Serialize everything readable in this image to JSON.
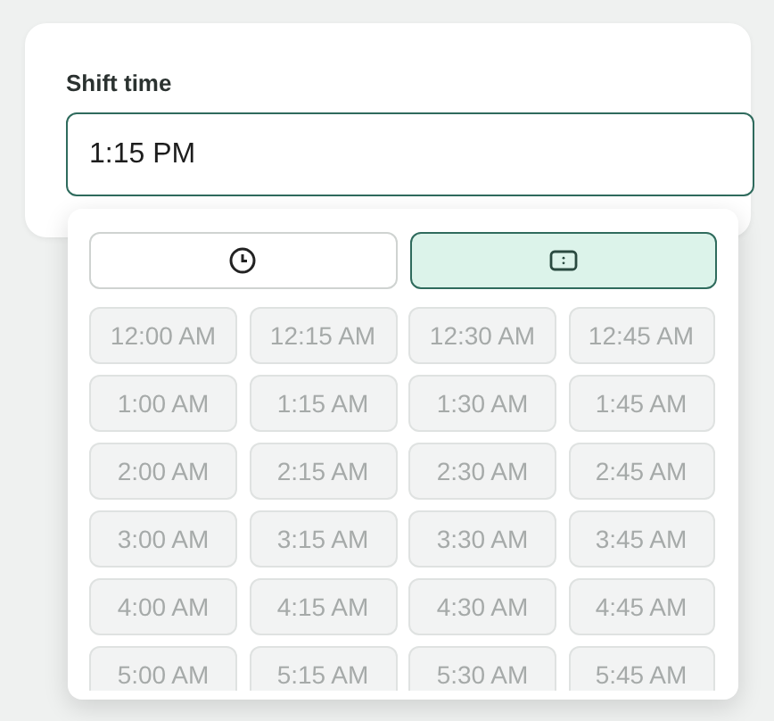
{
  "field": {
    "label": "Shift time",
    "value": "1:15 PM"
  },
  "modes": [
    {
      "kind": "clock",
      "selected": false
    },
    {
      "kind": "keyboard",
      "selected": true
    }
  ],
  "slots": [
    {
      "label": "12:00 AM",
      "disabled": true
    },
    {
      "label": "12:15 AM",
      "disabled": true
    },
    {
      "label": "12:30 AM",
      "disabled": true
    },
    {
      "label": "12:45 AM",
      "disabled": true
    },
    {
      "label": "1:00 AM",
      "disabled": true
    },
    {
      "label": "1:15 AM",
      "disabled": true
    },
    {
      "label": "1:30 AM",
      "disabled": true
    },
    {
      "label": "1:45 AM",
      "disabled": true
    },
    {
      "label": "2:00 AM",
      "disabled": true
    },
    {
      "label": "2:15 AM",
      "disabled": true
    },
    {
      "label": "2:30 AM",
      "disabled": true
    },
    {
      "label": "2:45 AM",
      "disabled": true
    },
    {
      "label": "3:00 AM",
      "disabled": true
    },
    {
      "label": "3:15 AM",
      "disabled": true
    },
    {
      "label": "3:30 AM",
      "disabled": true
    },
    {
      "label": "3:45 AM",
      "disabled": true
    },
    {
      "label": "4:00 AM",
      "disabled": true
    },
    {
      "label": "4:15 AM",
      "disabled": true
    },
    {
      "label": "4:30 AM",
      "disabled": true
    },
    {
      "label": "4:45 AM",
      "disabled": true
    },
    {
      "label": "5:00 AM",
      "disabled": true
    },
    {
      "label": "5:15 AM",
      "disabled": true
    },
    {
      "label": "5:30 AM",
      "disabled": true
    },
    {
      "label": "5:45 AM",
      "disabled": true
    }
  ]
}
